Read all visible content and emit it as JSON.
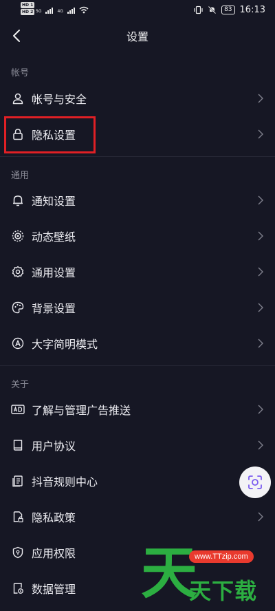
{
  "status_bar": {
    "hd1": "HD 1",
    "hd2": "HD 2",
    "net1": "5G",
    "net2": "4G",
    "battery": "83",
    "time": "16:13"
  },
  "header": {
    "title": "设置"
  },
  "sections": [
    {
      "title": "帐号",
      "items": [
        {
          "label": "帐号与安全",
          "icon": "user-icon"
        },
        {
          "label": "隐私设置",
          "icon": "lock-icon"
        }
      ]
    },
    {
      "title": "通用",
      "items": [
        {
          "label": "通知设置",
          "icon": "bell-icon"
        },
        {
          "label": "动态壁纸",
          "icon": "wallpaper-icon"
        },
        {
          "label": "通用设置",
          "icon": "gear-icon"
        },
        {
          "label": "背景设置",
          "icon": "palette-icon"
        },
        {
          "label": "大字简明模式",
          "icon": "font-a-icon"
        }
      ]
    },
    {
      "title": "关于",
      "items": [
        {
          "label": "了解与管理广告推送",
          "icon": "ad-icon"
        },
        {
          "label": "用户协议",
          "icon": "book-icon"
        },
        {
          "label": "抖音规则中心",
          "icon": "document-icon"
        },
        {
          "label": "隐私政策",
          "icon": "privacy-file-icon"
        },
        {
          "label": "应用权限",
          "icon": "shield-icon"
        },
        {
          "label": "数据管理",
          "icon": "data-settings-icon"
        }
      ]
    }
  ],
  "watermark": {
    "big": "天",
    "url": "www.TTzip.com",
    "text": "天下载"
  },
  "colors": {
    "background": "#161724",
    "highlight": "#e02025",
    "watermark_green": "#2cae41",
    "watermark_red": "#e93a2e"
  }
}
